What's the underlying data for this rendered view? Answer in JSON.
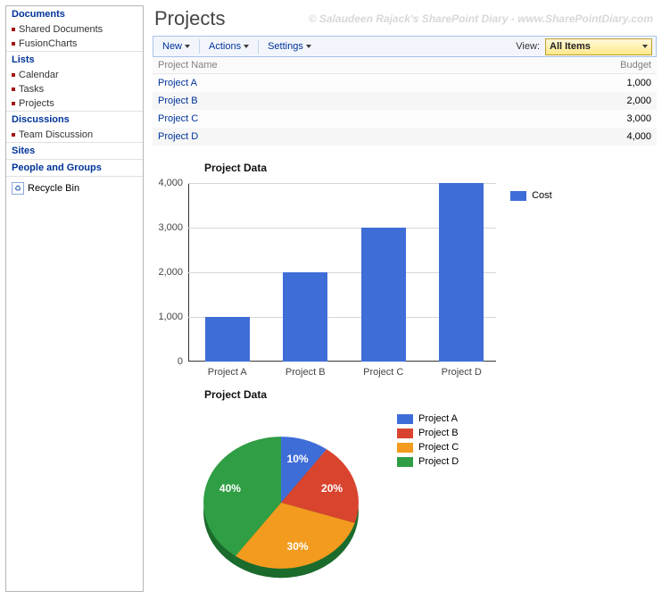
{
  "page_title": "Projects",
  "watermark": "© Salaudeen Rajack's SharePoint Diary - www.SharePointDiary.com",
  "sidebar": {
    "sections": [
      {
        "heading": "Documents",
        "items": [
          "Shared Documents",
          "FusionCharts"
        ]
      },
      {
        "heading": "Lists",
        "items": [
          "Calendar",
          "Tasks",
          "Projects"
        ]
      },
      {
        "heading": "Discussions",
        "items": [
          "Team Discussion"
        ]
      }
    ],
    "link_headings": [
      "Sites",
      "People and Groups"
    ],
    "recycle_label": "Recycle Bin"
  },
  "toolbar": {
    "new_label": "New",
    "actions_label": "Actions",
    "settings_label": "Settings",
    "view_prefix": "View:",
    "view_value": "All Items"
  },
  "table": {
    "col_name": "Project Name",
    "col_budget": "Budget",
    "rows": [
      {
        "name": "Project A",
        "budget": "1,000"
      },
      {
        "name": "Project B",
        "budget": "2,000"
      },
      {
        "name": "Project C",
        "budget": "3,000"
      },
      {
        "name": "Project D",
        "budget": "4,000"
      }
    ]
  },
  "chart_data": [
    {
      "type": "bar",
      "title": "Project Data",
      "categories": [
        "Project A",
        "Project B",
        "Project C",
        "Project D"
      ],
      "series": [
        {
          "name": "Cost",
          "values": [
            1000,
            2000,
            3000,
            4000
          ],
          "color": "#3f6dd8"
        }
      ],
      "ylim": [
        0,
        4000
      ],
      "y_ticks": [
        0,
        1000,
        2000,
        3000,
        4000
      ],
      "y_tick_labels": [
        "0",
        "1,000",
        "2,000",
        "3,000",
        "4,000"
      ]
    },
    {
      "type": "pie",
      "title": "Project Data",
      "slices": [
        {
          "name": "Project A",
          "value": 10,
          "label": "10%",
          "color": "#3f6dd8"
        },
        {
          "name": "Project B",
          "value": 20,
          "label": "20%",
          "color": "#d9442f"
        },
        {
          "name": "Project C",
          "value": 30,
          "label": "30%",
          "color": "#f29b1e"
        },
        {
          "name": "Project D",
          "value": 40,
          "label": "40%",
          "color": "#2f9e44"
        }
      ]
    }
  ]
}
